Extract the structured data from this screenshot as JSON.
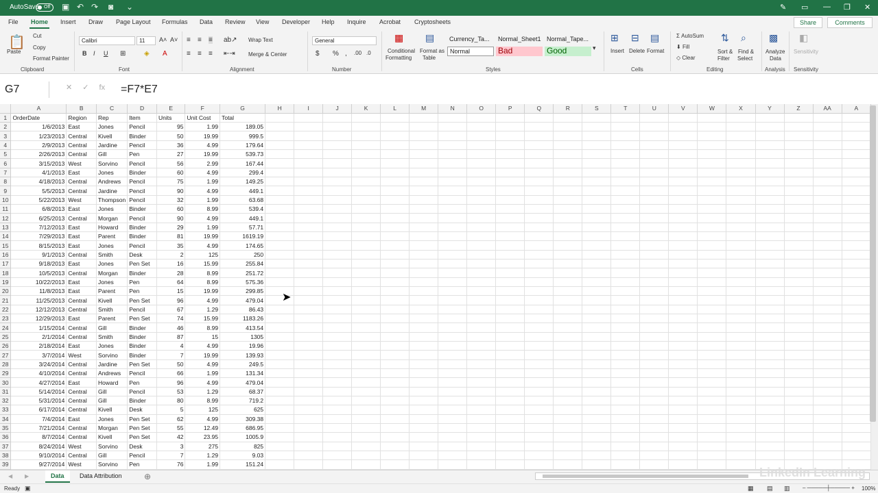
{
  "titlebar": {
    "autosave": "AutoSave",
    "toggle": "Off"
  },
  "tabs": [
    "File",
    "Home",
    "Insert",
    "Draw",
    "Page Layout",
    "Formulas",
    "Data",
    "Review",
    "View",
    "Developer",
    "Help",
    "Inquire",
    "Acrobat",
    "Cryptosheets"
  ],
  "share": "Share",
  "comments": "Comments",
  "ribbon": {
    "cut": "Cut",
    "copy": "Copy",
    "format_painter": "Format Painter",
    "paste": "Paste",
    "font": "Calibri",
    "size": "11",
    "wrap": "Wrap Text",
    "merge": "Merge & Center",
    "number_format": "General",
    "conditional": "Conditional",
    "formatting": "Formatting",
    "format_as": "Format as",
    "table": "Table",
    "styles": [
      "Currency_Ta...",
      "Normal_Sheet1",
      "Normal_Tape...",
      "Normal",
      "Bad",
      "Good"
    ],
    "insert": "Insert",
    "delete": "Delete",
    "format": "Format",
    "autosum": "AutoSum",
    "fill": "Fill",
    "clear": "Clear",
    "sort": "Sort &",
    "filter": "Filter",
    "find": "Find &",
    "select": "Select",
    "analyze": "Analyze",
    "data": "Data",
    "sensitivity": "Sensitivity",
    "groups": [
      "Clipboard",
      "Font",
      "Alignment",
      "Number",
      "Styles",
      "Cells",
      "Editing",
      "Analysis",
      "Sensitivity"
    ]
  },
  "namebox": "G7",
  "formula": "=F7*E7",
  "columns": [
    "A",
    "B",
    "C",
    "D",
    "E",
    "F",
    "G",
    "H",
    "I",
    "J",
    "K",
    "L",
    "M",
    "N",
    "O",
    "P",
    "Q",
    "R",
    "S",
    "T",
    "U",
    "V",
    "W",
    "X",
    "Y",
    "Z",
    "AA",
    "A"
  ],
  "header_row": [
    "OrderDate",
    "Region",
    "Rep",
    "Item",
    "Units",
    "Unit Cost",
    "Total"
  ],
  "rows": [
    [
      "1/6/2013",
      "East",
      "Jones",
      "Pencil",
      "95",
      "1.99",
      "189.05"
    ],
    [
      "1/23/2013",
      "Central",
      "Kivell",
      "Binder",
      "50",
      "19.99",
      "999.5"
    ],
    [
      "2/9/2013",
      "Central",
      "Jardine",
      "Pencil",
      "36",
      "4.99",
      "179.64"
    ],
    [
      "2/26/2013",
      "Central",
      "Gill",
      "Pen",
      "27",
      "19.99",
      "539.73"
    ],
    [
      "3/15/2013",
      "West",
      "Sorvino",
      "Pencil",
      "56",
      "2.99",
      "167.44"
    ],
    [
      "4/1/2013",
      "East",
      "Jones",
      "Binder",
      "60",
      "4.99",
      "299.4"
    ],
    [
      "4/18/2013",
      "Central",
      "Andrews",
      "Pencil",
      "75",
      "1.99",
      "149.25"
    ],
    [
      "5/5/2013",
      "Central",
      "Jardine",
      "Pencil",
      "90",
      "4.99",
      "449.1"
    ],
    [
      "5/22/2013",
      "West",
      "Thompson",
      "Pencil",
      "32",
      "1.99",
      "63.68"
    ],
    [
      "6/8/2013",
      "East",
      "Jones",
      "Binder",
      "60",
      "8.99",
      "539.4"
    ],
    [
      "6/25/2013",
      "Central",
      "Morgan",
      "Pencil",
      "90",
      "4.99",
      "449.1"
    ],
    [
      "7/12/2013",
      "East",
      "Howard",
      "Binder",
      "29",
      "1.99",
      "57.71"
    ],
    [
      "7/29/2013",
      "East",
      "Parent",
      "Binder",
      "81",
      "19.99",
      "1619.19"
    ],
    [
      "8/15/2013",
      "East",
      "Jones",
      "Pencil",
      "35",
      "4.99",
      "174.65"
    ],
    [
      "9/1/2013",
      "Central",
      "Smith",
      "Desk",
      "2",
      "125",
      "250"
    ],
    [
      "9/18/2013",
      "East",
      "Jones",
      "Pen Set",
      "16",
      "15.99",
      "255.84"
    ],
    [
      "10/5/2013",
      "Central",
      "Morgan",
      "Binder",
      "28",
      "8.99",
      "251.72"
    ],
    [
      "10/22/2013",
      "East",
      "Jones",
      "Pen",
      "64",
      "8.99",
      "575.36"
    ],
    [
      "11/8/2013",
      "East",
      "Parent",
      "Pen",
      "15",
      "19.99",
      "299.85"
    ],
    [
      "11/25/2013",
      "Central",
      "Kivell",
      "Pen Set",
      "96",
      "4.99",
      "479.04"
    ],
    [
      "12/12/2013",
      "Central",
      "Smith",
      "Pencil",
      "67",
      "1.29",
      "86.43"
    ],
    [
      "12/29/2013",
      "East",
      "Parent",
      "Pen Set",
      "74",
      "15.99",
      "1183.26"
    ],
    [
      "1/15/2014",
      "Central",
      "Gill",
      "Binder",
      "46",
      "8.99",
      "413.54"
    ],
    [
      "2/1/2014",
      "Central",
      "Smith",
      "Binder",
      "87",
      "15",
      "1305"
    ],
    [
      "2/18/2014",
      "East",
      "Jones",
      "Binder",
      "4",
      "4.99",
      "19.96"
    ],
    [
      "3/7/2014",
      "West",
      "Sorvino",
      "Binder",
      "7",
      "19.99",
      "139.93"
    ],
    [
      "3/24/2014",
      "Central",
      "Jardine",
      "Pen Set",
      "50",
      "4.99",
      "249.5"
    ],
    [
      "4/10/2014",
      "Central",
      "Andrews",
      "Pencil",
      "66",
      "1.99",
      "131.34"
    ],
    [
      "4/27/2014",
      "East",
      "Howard",
      "Pen",
      "96",
      "4.99",
      "479.04"
    ],
    [
      "5/14/2014",
      "Central",
      "Gill",
      "Pencil",
      "53",
      "1.29",
      "68.37"
    ],
    [
      "5/31/2014",
      "Central",
      "Gill",
      "Binder",
      "80",
      "8.99",
      "719.2"
    ],
    [
      "6/17/2014",
      "Central",
      "Kivell",
      "Desk",
      "5",
      "125",
      "625"
    ],
    [
      "7/4/2014",
      "East",
      "Jones",
      "Pen Set",
      "62",
      "4.99",
      "309.38"
    ],
    [
      "7/21/2014",
      "Central",
      "Morgan",
      "Pen Set",
      "55",
      "12.49",
      "686.95"
    ],
    [
      "8/7/2014",
      "Central",
      "Kivell",
      "Pen Set",
      "42",
      "23.95",
      "1005.9"
    ],
    [
      "8/24/2014",
      "West",
      "Sorvino",
      "Desk",
      "3",
      "275",
      "825"
    ],
    [
      "9/10/2014",
      "Central",
      "Gill",
      "Pencil",
      "7",
      "1.29",
      "9.03"
    ],
    [
      "9/27/2014",
      "West",
      "Sorvino",
      "Pen",
      "76",
      "1.99",
      "151.24"
    ]
  ],
  "sheets": [
    "Data",
    "Data Attribution"
  ],
  "status": {
    "ready": "Ready",
    "zoom": "100%"
  },
  "watermark": "LinkedIn Learning"
}
